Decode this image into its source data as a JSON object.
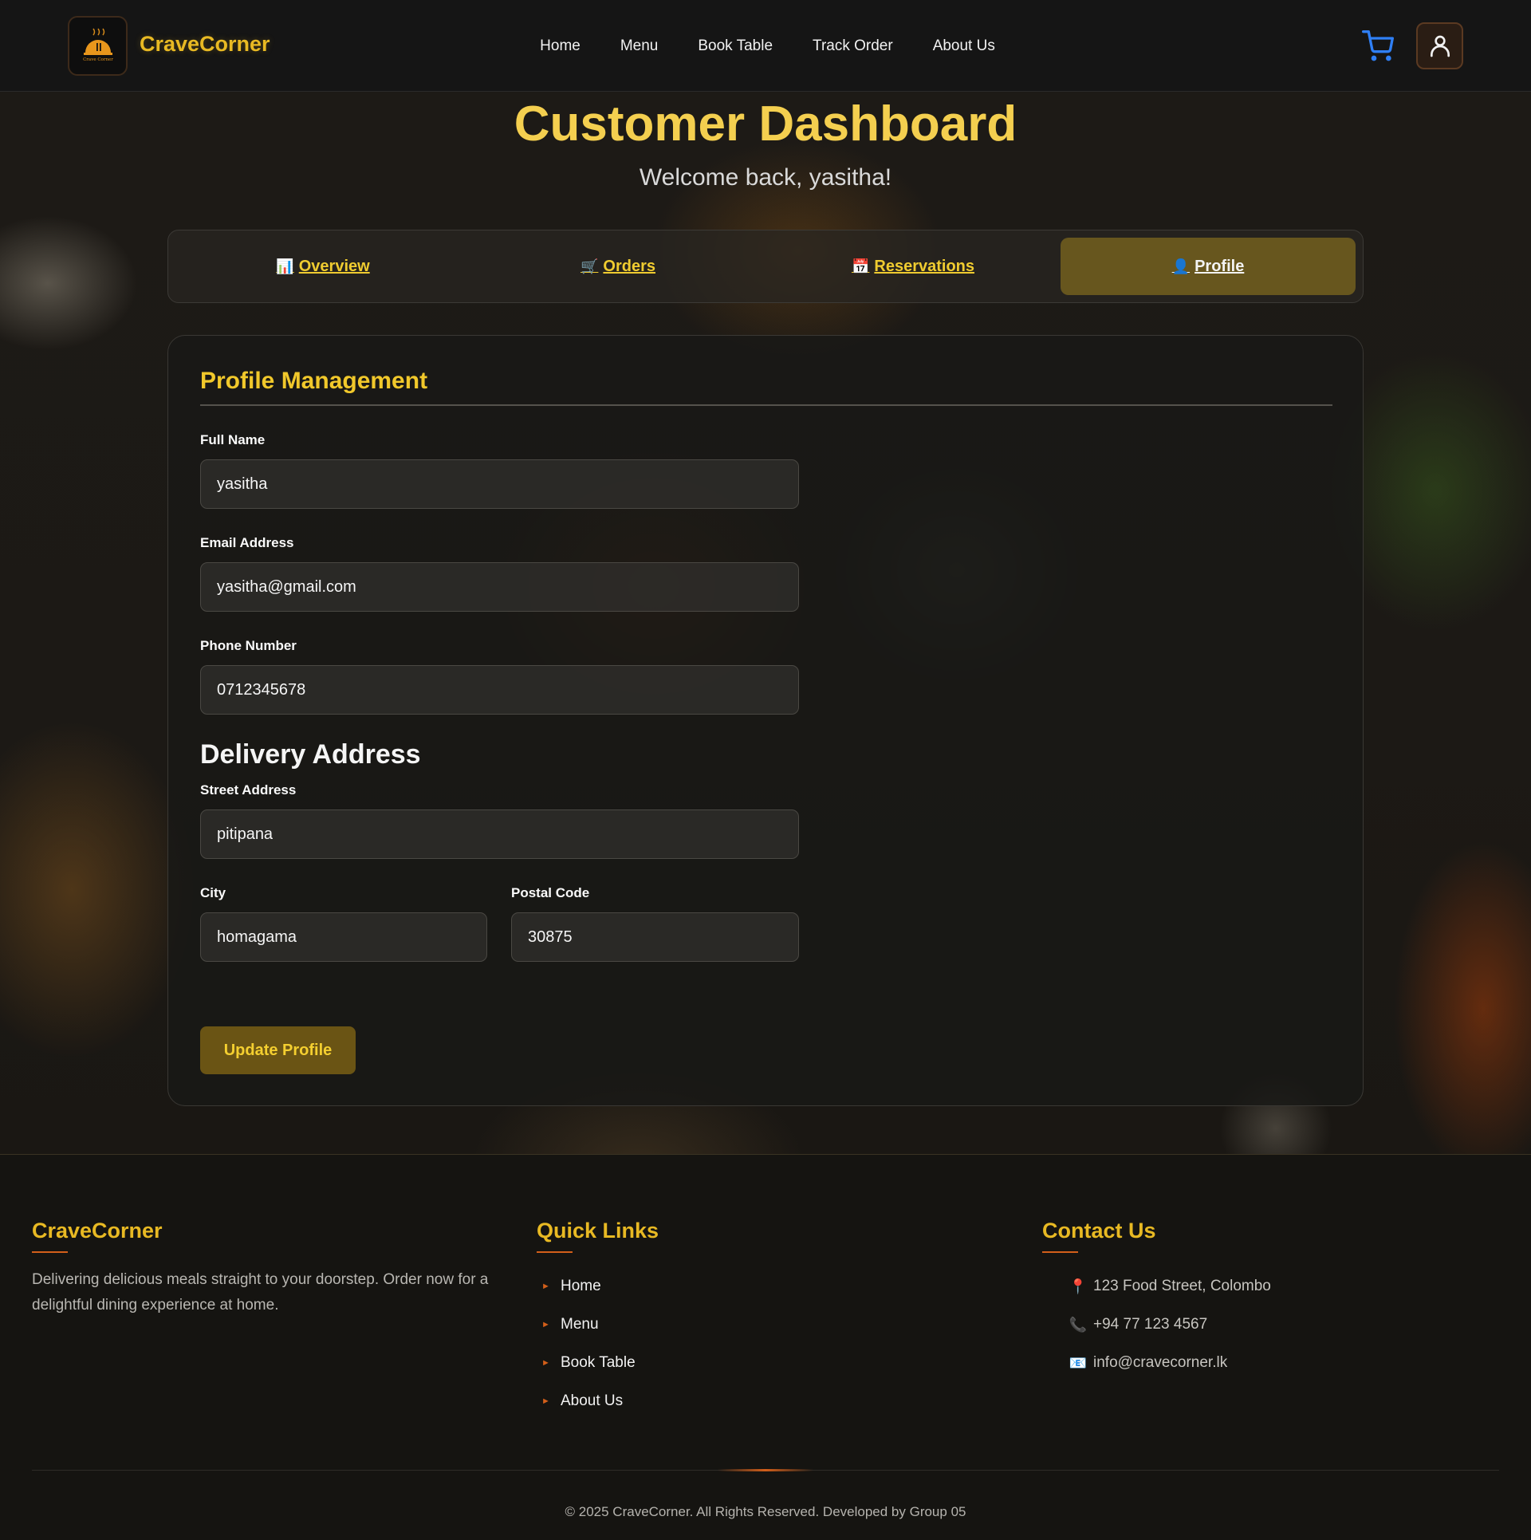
{
  "navbar": {
    "brand": "CraveCorner",
    "logo_text": "Crave Corner",
    "links": [
      "Home",
      "Menu",
      "Book Table",
      "Track Order",
      "About Us"
    ],
    "cart_icon": "cart-icon",
    "user_icon": "user-icon",
    "accent_color": "#e8b923"
  },
  "hero": {
    "title": "Customer Dashboard",
    "subtitle": "Welcome back, yasitha!"
  },
  "tabs": [
    {
      "icon": "📊",
      "label": "Overview",
      "active": false
    },
    {
      "icon": "🛒",
      "label": "Orders",
      "active": false
    },
    {
      "icon": "📅",
      "label": "Reservations",
      "active": false
    },
    {
      "icon": "👤",
      "label": "Profile",
      "active": true
    }
  ],
  "profile": {
    "title": "Profile Management",
    "full_name_label": "Full Name",
    "full_name": "yasitha",
    "email_label": "Email Address",
    "email": "yasitha@gmail.com",
    "phone_label": "Phone Number",
    "phone": "0712345678",
    "delivery_heading": "Delivery Address",
    "street_label": "Street Address",
    "street": "pitipana",
    "city_label": "City",
    "city": "homagama",
    "postal_label": "Postal Code",
    "postal": "30875",
    "update_button": "Update Profile"
  },
  "footer": {
    "brand": "CraveCorner",
    "description": "Delivering delicious meals straight to your doorstep. Order now for a delightful dining experience at home.",
    "quick_links_title": "Quick Links",
    "quick_links": [
      "Home",
      "Menu",
      "Book Table",
      "About Us"
    ],
    "contact_title": "Contact Us",
    "contact": [
      {
        "icon": "📍",
        "text": "123 Food Street, Colombo"
      },
      {
        "icon": "📞",
        "text": "+94 77 123 4567"
      },
      {
        "icon": "📧",
        "text": "info@cravecorner.lk"
      }
    ],
    "copyright": "© 2025 CraveCorner. All Rights Reserved. Developed by Group 05"
  }
}
